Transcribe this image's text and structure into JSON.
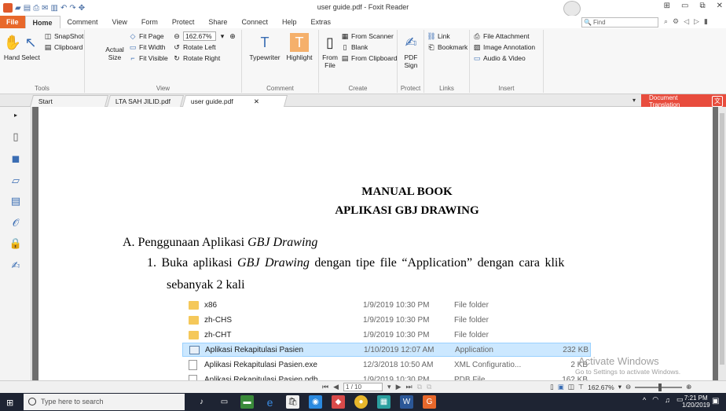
{
  "window": {
    "title": "user guide.pdf - Foxit Reader"
  },
  "ribbon_tabs": [
    {
      "label": "File"
    },
    {
      "label": "Home"
    },
    {
      "label": "Comment"
    },
    {
      "label": "View"
    },
    {
      "label": "Form"
    },
    {
      "label": "Protect"
    },
    {
      "label": "Share"
    },
    {
      "label": "Connect"
    },
    {
      "label": "Help"
    },
    {
      "label": "Extras"
    }
  ],
  "search": {
    "placeholder": "Find"
  },
  "ribbon": {
    "tools": {
      "label": "Tools",
      "hand": "Hand",
      "select": "Select",
      "snapshot": "SnapShot",
      "clipboard": "Clipboard"
    },
    "view": {
      "label": "View",
      "actual_size": "Actual Size",
      "fit_page": "Fit Page",
      "fit_width": "Fit Width",
      "fit_visible": "Fit Visible",
      "zoom": "162.67%",
      "rotate_left": "Rotate Left",
      "rotate_right": "Rotate Right"
    },
    "comment": {
      "label": "Comment",
      "typewriter": "Typewriter",
      "highlight": "Highlight"
    },
    "create": {
      "label": "Create",
      "from_file": "From File",
      "from_scanner": "From Scanner",
      "blank": "Blank",
      "from_clipboard": "From Clipboard"
    },
    "protect": {
      "label": "Protect",
      "pdf_sign": "PDF Sign"
    },
    "links": {
      "label": "Links",
      "link": "Link",
      "bookmark": "Bookmark"
    },
    "insert": {
      "label": "Insert",
      "file_attachment": "File Attachment",
      "image_annotation": "Image Annotation",
      "audio_video": "Audio & Video"
    }
  },
  "doc_tabs": [
    {
      "label": "Start"
    },
    {
      "label": "LTA SAH JILID.pdf"
    },
    {
      "label": "user guide.pdf"
    }
  ],
  "doc_translation": "Document Translation",
  "document": {
    "title1": "MANUAL BOOK",
    "title2": "APLIKASI GBJ DRAWING",
    "section_prefix": "A.  Penggunaan Aplikasi ",
    "section_app": "GBJ Drawing",
    "step_prefix": "1.  Buka aplikasi ",
    "step_app": "GBJ Drawing",
    "step_suffix": " dengan tipe file “Application” dengan cara klik",
    "step_line2": "sebanyak 2 kali"
  },
  "files": [
    {
      "name": "x86",
      "date": "1/9/2019 10:30 PM",
      "type": "File folder",
      "size": "",
      "icon": "folder"
    },
    {
      "name": "zh-CHS",
      "date": "1/9/2019 10:30 PM",
      "type": "File folder",
      "size": "",
      "icon": "folder"
    },
    {
      "name": "zh-CHT",
      "date": "1/9/2019 10:30 PM",
      "type": "File folder",
      "size": "",
      "icon": "folder"
    },
    {
      "name": "Aplikasi Rekapitulasi Pasien",
      "date": "1/10/2019 12:07 AM",
      "type": "Application",
      "size": "232 KB",
      "icon": "app"
    },
    {
      "name": "Aplikasi Rekapitulasi Pasien.exe",
      "date": "12/3/2018 10:50 AM",
      "type": "XML Configuratio...",
      "size": "2 KB",
      "icon": "file"
    },
    {
      "name": "Aplikasi Rekapitulasi Pasien.pdb",
      "date": "1/9/2019 10:30 PM",
      "type": "PDB File",
      "size": "162 KB",
      "icon": "file"
    }
  ],
  "watermark": {
    "line1": "Activate Windows",
    "line2": "Go to Settings to activate Windows."
  },
  "status": {
    "page": "1 / 10",
    "zoom": "162.67%"
  },
  "taskbar": {
    "search_placeholder": "Type here to search",
    "time": "7:21 PM",
    "date": "1/20/2019"
  }
}
